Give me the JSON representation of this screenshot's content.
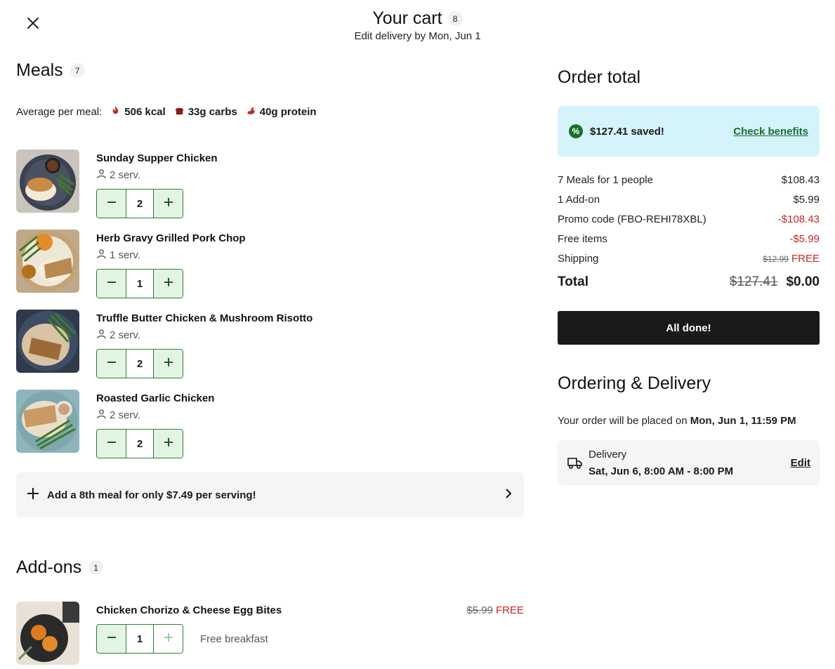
{
  "header": {
    "title": "Your cart",
    "count": "8",
    "subtitle": "Edit delivery by Mon, Jun 1"
  },
  "meals": {
    "title": "Meals",
    "count": "7",
    "avg_label": "Average per meal:",
    "kcal": "506 kcal",
    "carbs": "33g carbs",
    "protein": "40g protein",
    "items": [
      {
        "name": "Sunday Supper Chicken",
        "serv": "2 serv.",
        "qty": "2"
      },
      {
        "name": "Herb Gravy Grilled Pork Chop",
        "serv": "1 serv.",
        "qty": "1"
      },
      {
        "name": "Truffle Butter Chicken & Mushroom Risotto",
        "serv": "2 serv.",
        "qty": "2"
      },
      {
        "name": "Roasted Garlic Chicken",
        "serv": "2 serv.",
        "qty": "2"
      }
    ],
    "add_meal": "Add a 8th meal for only $7.49 per serving!"
  },
  "addons": {
    "title": "Add-ons",
    "count": "1",
    "items": [
      {
        "name": "Chicken Chorizo & Cheese Egg Bites",
        "qty": "1",
        "old_price": "$5.99",
        "price": "FREE",
        "note": "Free breakfast"
      }
    ]
  },
  "order": {
    "title": "Order total",
    "saved": "$127.41 saved!",
    "benefits_link": "Check benefits",
    "lines": [
      {
        "label": "7 Meals for 1 people",
        "value": "$108.43"
      },
      {
        "label": "1 Add-on",
        "value": "$5.99"
      },
      {
        "label": "Promo code (FBO-REHI78XBL)",
        "value": "-$108.43"
      },
      {
        "label": "Free items",
        "value": "-$5.99"
      }
    ],
    "shipping_label": "Shipping",
    "shipping_old": "$12.99",
    "shipping_value": "FREE",
    "total_label": "Total",
    "total_old": "$127.41",
    "total_value": "$0.00",
    "done_button": "All done!"
  },
  "delivery": {
    "title": "Ordering & Delivery",
    "placed_prefix": "Your order will be placed on",
    "placed_date": "Mon, Jun 1, 11:59 PM",
    "label": "Delivery",
    "window": "Sat, Jun 6, 8:00 AM - 8:00 PM",
    "edit": "Edit"
  },
  "colors": {
    "accent_green": "#2e7d32",
    "stepper_bg": "#e3f4e4",
    "saved_bg": "#d4f3fb",
    "negative_red": "#c62828",
    "button_dark": "#1a1a1a"
  },
  "icons": [
    "close-icon",
    "fire-icon",
    "bread-icon",
    "muscle-icon",
    "person-icon",
    "minus-icon",
    "plus-icon",
    "chevron-right-icon",
    "percent-icon",
    "truck-icon"
  ]
}
